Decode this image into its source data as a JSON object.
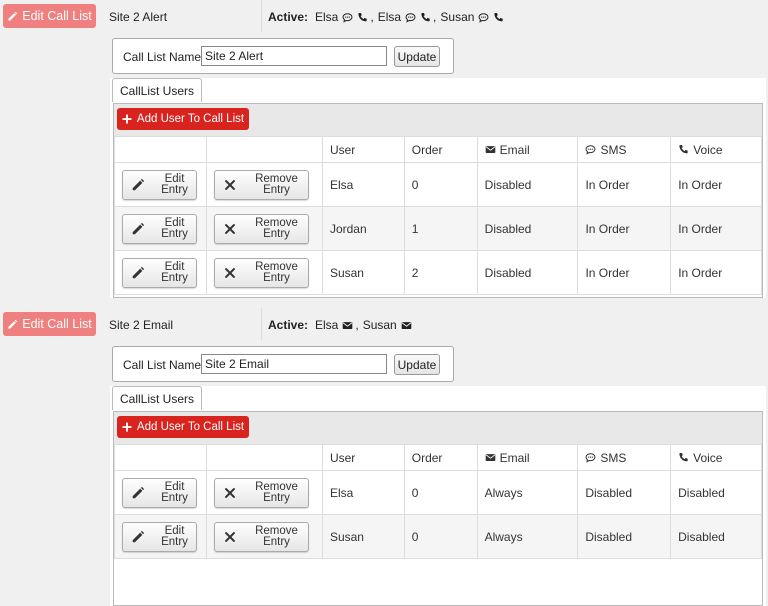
{
  "blocks": [
    {
      "edit_call_list_label": "Edit Call List",
      "name": "Site 2 Alert",
      "active_label": "Active:",
      "active_entries": [
        {
          "user": "Elsa",
          "icons": [
            "sms-icon",
            "phone-icon"
          ]
        },
        {
          "user": "Elsa",
          "icons": [
            "sms-icon",
            "phone-icon"
          ]
        },
        {
          "user": "Susan",
          "icons": [
            "sms-icon",
            "phone-icon"
          ]
        }
      ],
      "name_label": "Call List Name",
      "name_value": "Site 2 Alert",
      "update_label": "Update",
      "tab_label": "CallList Users",
      "add_user_label": "Add User To Call List",
      "columns": [
        "",
        "",
        "User",
        "Order",
        "Email",
        "SMS",
        "Voice"
      ],
      "column_icons": [
        "",
        "",
        "",
        "",
        "envelope-icon",
        "sms-icon",
        "phone-icon"
      ],
      "edit_entry_label": [
        "Edit",
        "Entry"
      ],
      "remove_entry_label": [
        "Remove",
        "Entry"
      ],
      "rows": [
        {
          "user": "Elsa",
          "order": "0",
          "email": "Disabled",
          "sms": "In Order",
          "voice": "In Order"
        },
        {
          "user": "Jordan",
          "order": "1",
          "email": "Disabled",
          "sms": "In Order",
          "voice": "In Order"
        },
        {
          "user": "Susan",
          "order": "2",
          "email": "Disabled",
          "sms": "In Order",
          "voice": "In Order"
        }
      ]
    },
    {
      "edit_call_list_label": "Edit Call List",
      "name": "Site 2 Email",
      "active_label": "Active:",
      "active_entries": [
        {
          "user": "Elsa",
          "icons": [
            "envelope-icon"
          ]
        },
        {
          "user": "Susan",
          "icons": [
            "envelope-icon"
          ]
        }
      ],
      "name_label": "Call List Name",
      "name_value": "Site 2 Email",
      "update_label": "Update",
      "tab_label": "CallList Users",
      "add_user_label": "Add User To Call List",
      "columns": [
        "",
        "",
        "User",
        "Order",
        "Email",
        "SMS",
        "Voice"
      ],
      "column_icons": [
        "",
        "",
        "",
        "",
        "envelope-icon",
        "sms-icon",
        "phone-icon"
      ],
      "edit_entry_label": [
        "Edit",
        "Entry"
      ],
      "remove_entry_label": [
        "Remove",
        "Entry"
      ],
      "rows": [
        {
          "user": "Elsa",
          "order": "0",
          "email": "Always",
          "sms": "Disabled",
          "voice": "Disabled"
        },
        {
          "user": "Susan",
          "order": "0",
          "email": "Always",
          "sms": "Disabled",
          "voice": "Disabled"
        }
      ]
    }
  ],
  "colors": {
    "edit_call_list_bg": "#f07f7f",
    "add_user_bg": "#d9231f",
    "page_bg": "#f0f0f0"
  }
}
